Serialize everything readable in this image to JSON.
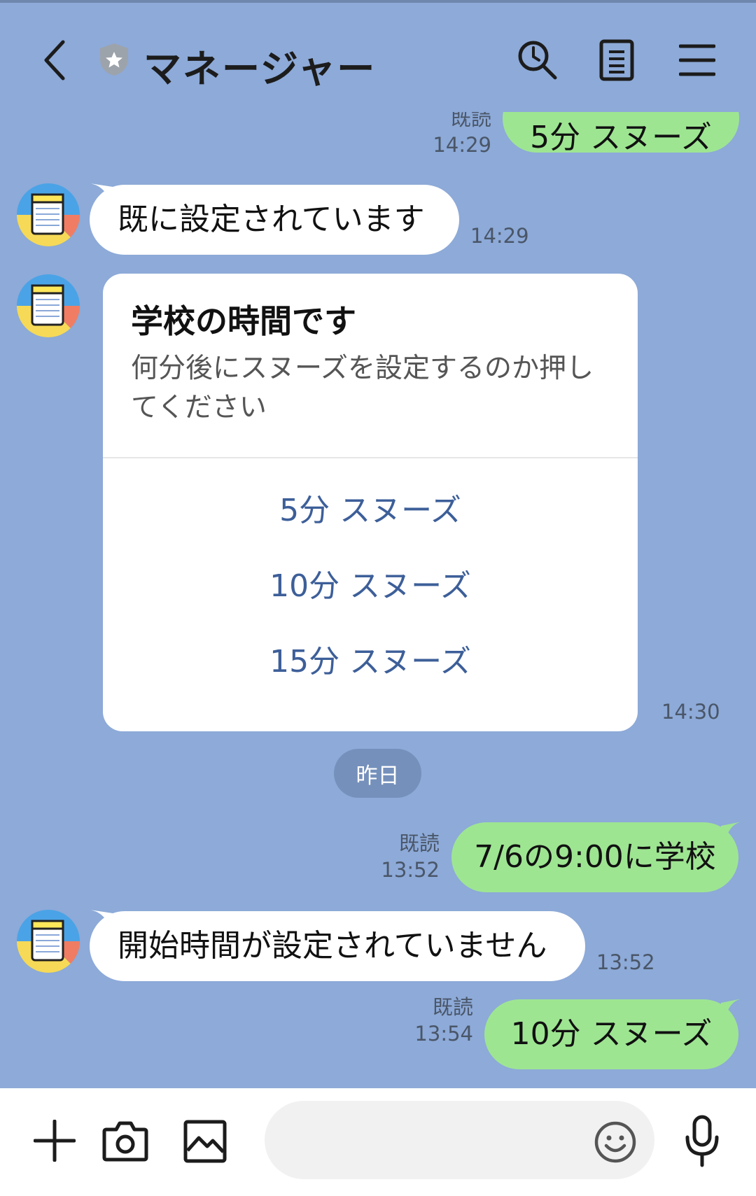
{
  "header": {
    "title": "マネージャー",
    "icons": [
      "back-icon",
      "shield-star-icon",
      "search-icon",
      "notes-icon",
      "menu-icon"
    ]
  },
  "messages": {
    "m1": {
      "text": "5分 スヌーズ",
      "read": "既読",
      "time": "14:29"
    },
    "m2": {
      "text": "既に設定されています",
      "time": "14:29"
    },
    "card": {
      "title": "学校の時間です",
      "description": "何分後にスヌーズを設定するのか押してください",
      "actions": [
        "5分 スヌーズ",
        "10分 スヌーズ",
        "15分 スヌーズ"
      ],
      "time": "14:30"
    },
    "date_separator": "昨日",
    "m3": {
      "text": "7/6の9:00に学校",
      "read": "既読",
      "time": "13:52"
    },
    "m4": {
      "text": "開始時間が設定されていません",
      "time": "13:52"
    },
    "m5": {
      "text": "10分 スヌーズ",
      "read": "既読",
      "time": "13:54"
    }
  },
  "input": {
    "placeholder": "",
    "icons": [
      "plus-icon",
      "camera-icon",
      "image-icon",
      "emoji-icon",
      "mic-icon"
    ]
  },
  "colors": {
    "background": "#8daad8",
    "outgoing_bubble": "#9ee592",
    "incoming_bubble": "#ffffff",
    "action_text": "#3d5f99"
  }
}
